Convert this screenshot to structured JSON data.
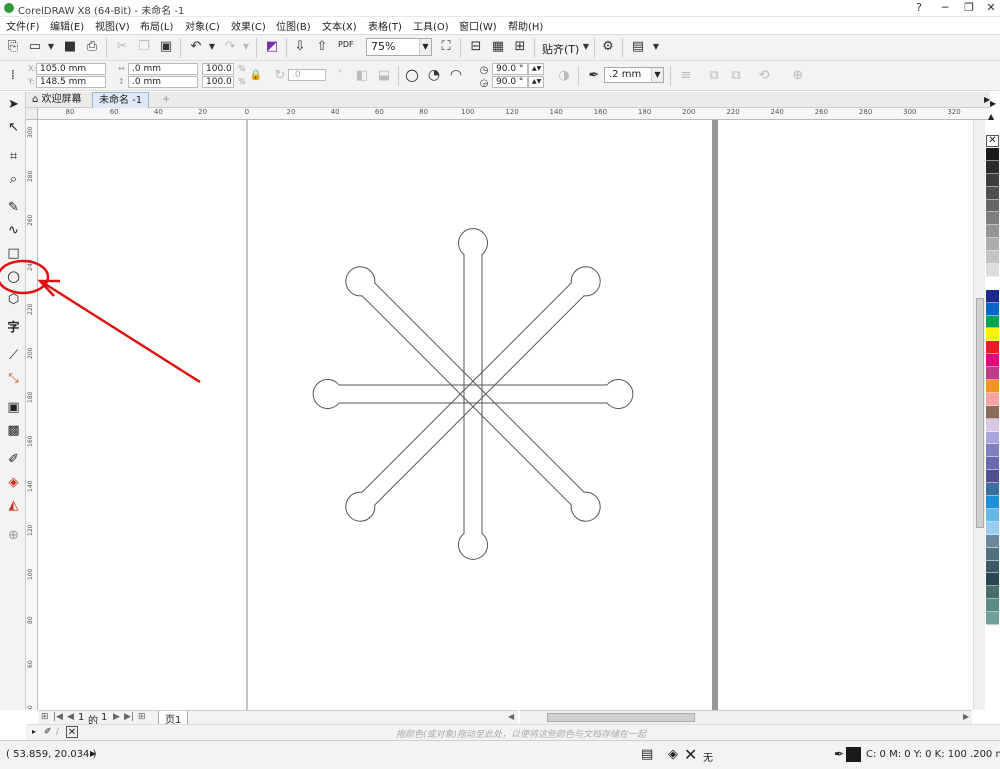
{
  "window": {
    "title": "CorelDRAW X8 (64-Bit) - 未命名 -1",
    "controls": [
      "?",
      "─",
      "❐",
      "✕"
    ]
  },
  "menu": [
    "文件(F)",
    "编辑(E)",
    "视图(V)",
    "布局(L)",
    "对象(C)",
    "效果(C)",
    "位图(B)",
    "文本(X)",
    "表格(T)",
    "工具(O)",
    "窗口(W)",
    "帮助(H)"
  ],
  "toolbar": {
    "zoom": "75%",
    "snap_label": "贴齐(T)",
    "pdf_label": "PDF"
  },
  "properties": {
    "x": "105.0 mm",
    "y": "148.5 mm",
    "width": ".0 mm",
    "height": ".0 mm",
    "scale_w": "100.0",
    "scale_h": "100.0",
    "percent": "%",
    "rotation": ".0",
    "start_angle": "90.0 °",
    "end_angle": "90.0 °",
    "outline_width": ".2 mm"
  },
  "tabs": [
    {
      "label": "欢迎屏幕",
      "active": false
    },
    {
      "label": "未命名 -1",
      "active": true
    }
  ],
  "ruler": {
    "h_labels": [
      "80",
      "60",
      "40",
      "20",
      "0",
      "20",
      "40",
      "60",
      "80",
      "100",
      "120",
      "140",
      "160",
      "180",
      "200",
      "220",
      "240",
      "260",
      "280",
      "300",
      "320"
    ],
    "v_labels": [
      "300",
      "280",
      "260",
      "240",
      "220",
      "200",
      "180",
      "160",
      "140",
      "120",
      "100",
      "80",
      "60",
      "40",
      "20"
    ]
  },
  "page_nav": {
    "current": "1",
    "of_label": "的",
    "total": "1",
    "page_tab": "页1"
  },
  "docpalette_hint": "拖颜色(或对象)拖动至此处，以便将这些颜色与文档存储在一起",
  "status": {
    "coords": "( 53.859, 20.034 )",
    "fill_label": "无",
    "color_info": "C: 0 M: 0 Y: 0 K: 100  .200 mm"
  },
  "palette_colors": [
    "#1a1a1a",
    "#2b2b2b",
    "#3d3d3d",
    "#505050",
    "#666666",
    "#7d7d7d",
    "#959595",
    "#adadad",
    "#c4c4c4",
    "#dcdcdc",
    "#ffffff",
    "#1a2a8c",
    "#0066cc",
    "#00a651",
    "#fff200",
    "#ed1c24",
    "#e6007e",
    "#c03b8c",
    "#f7941d",
    "#f4a4a4",
    "#8c6a5a",
    "#d8c8e8",
    "#a6a6d9",
    "#8080c0",
    "#6a6ab0",
    "#50508c",
    "#3a6fa0",
    "#1f8fd8",
    "#66b8e8",
    "#99ccf0",
    "#6c8898",
    "#52707e",
    "#3c5866",
    "#2a4650",
    "#466e6a",
    "#5a8a84",
    "#70a09a"
  ],
  "icons": {
    "home": "home-icon",
    "arrow": "annotation-arrow"
  }
}
